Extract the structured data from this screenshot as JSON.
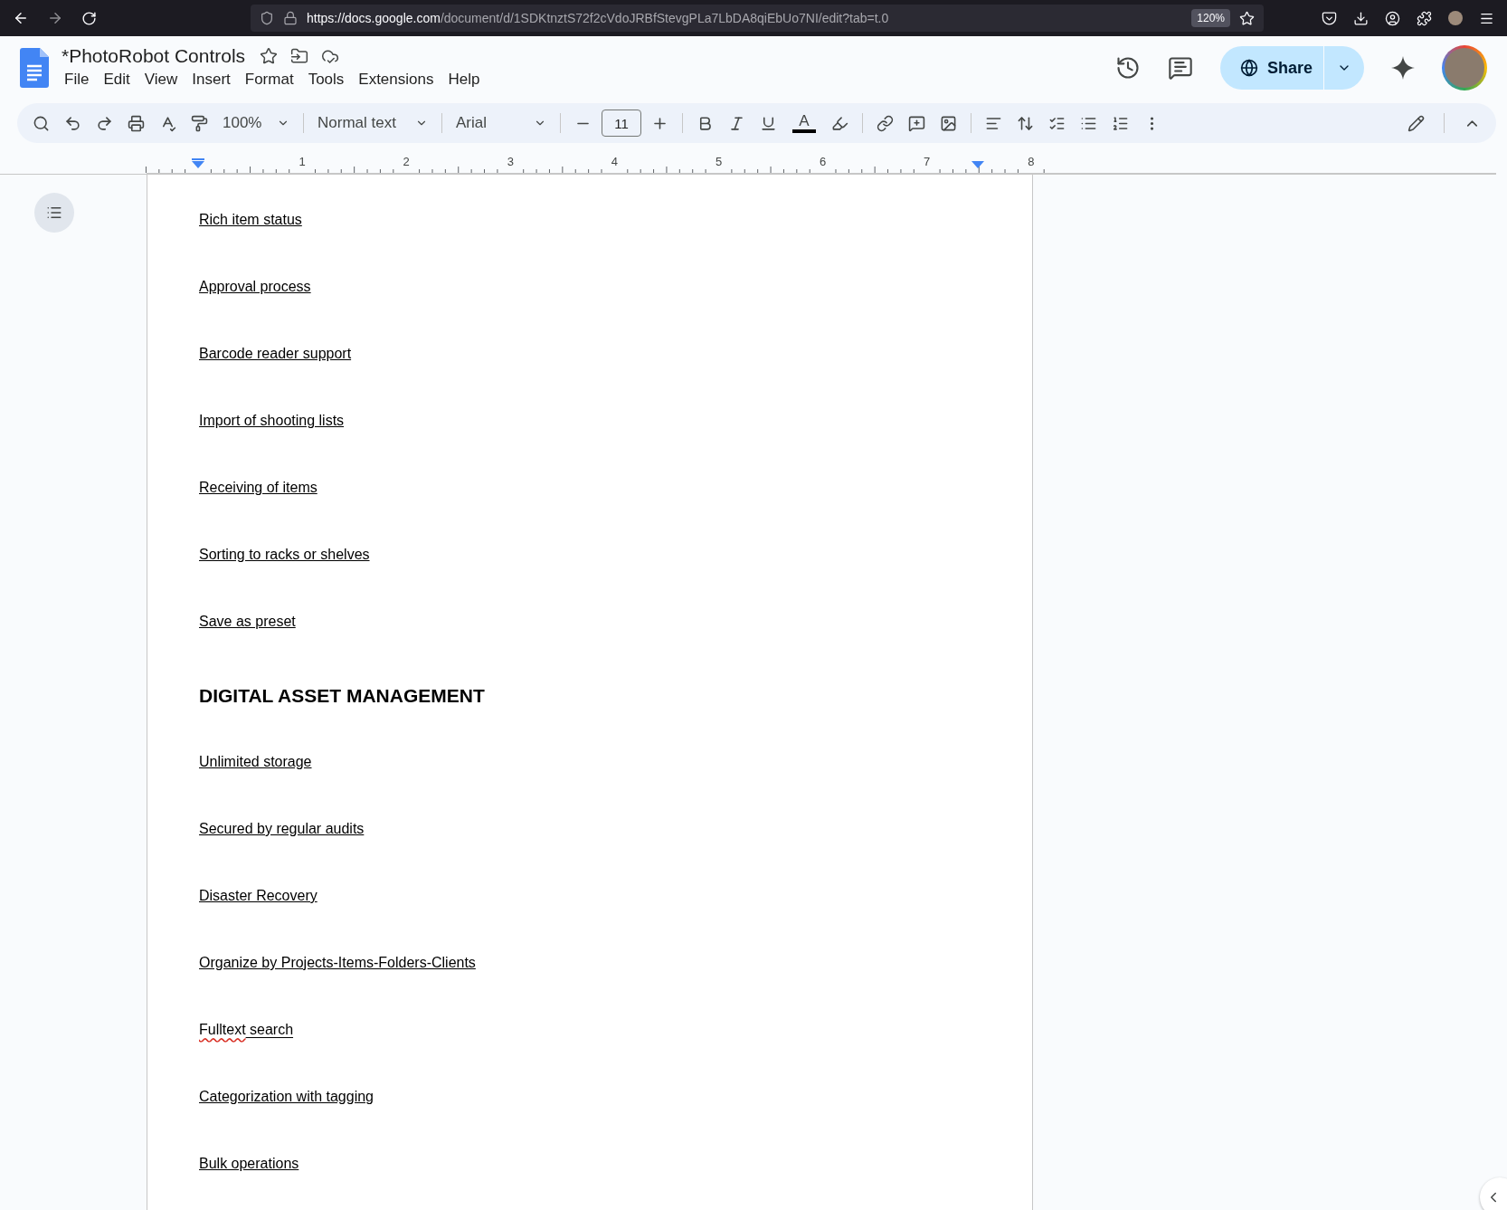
{
  "browser": {
    "url_host": "https://docs.google.com",
    "url_path": "/document/d/1SDKtnztS72f2cVdoJRBfStevgPLa7LbDA8qiEbUo7NI/edit?tab=t.0",
    "zoom": "120%"
  },
  "docs": {
    "title": "*PhotoRobot Controls",
    "menu": [
      "File",
      "Edit",
      "View",
      "Insert",
      "Format",
      "Tools",
      "Extensions",
      "Help"
    ],
    "share": "Share"
  },
  "toolbar": {
    "zoom": "100%",
    "style": "Normal text",
    "font": "Arial",
    "font_size": "11",
    "text_color_glyph": "A"
  },
  "ruler": [
    "1",
    "2",
    "3",
    "4",
    "5",
    "6",
    "7",
    "8"
  ],
  "document": [
    {
      "kind": "link",
      "text": "Rich item status"
    },
    {
      "kind": "link",
      "text": "Approval process"
    },
    {
      "kind": "link",
      "text": "Barcode reader support"
    },
    {
      "kind": "link",
      "text": "Import of shooting lists"
    },
    {
      "kind": "link",
      "text": "Receiving of items"
    },
    {
      "kind": "link",
      "text": "Sorting to racks or shelves"
    },
    {
      "kind": "link",
      "text": "Save as preset"
    },
    {
      "kind": "heading",
      "text": "DIGITAL ASSET MANAGEMENT"
    },
    {
      "kind": "link",
      "text": "Unlimited storage"
    },
    {
      "kind": "link",
      "text": "Secured by regular audits"
    },
    {
      "kind": "link",
      "text": "Disaster Recovery"
    },
    {
      "kind": "link",
      "text": "Organize by Projects-Items-Folders-Clients"
    },
    {
      "kind": "link",
      "parts": [
        {
          "text": "Fulltext",
          "misspelled": true
        },
        {
          "text": " search",
          "misspelled": false
        }
      ]
    },
    {
      "kind": "link",
      "text": "Categorization with tagging"
    },
    {
      "kind": "link",
      "text": "Bulk operations"
    }
  ]
}
